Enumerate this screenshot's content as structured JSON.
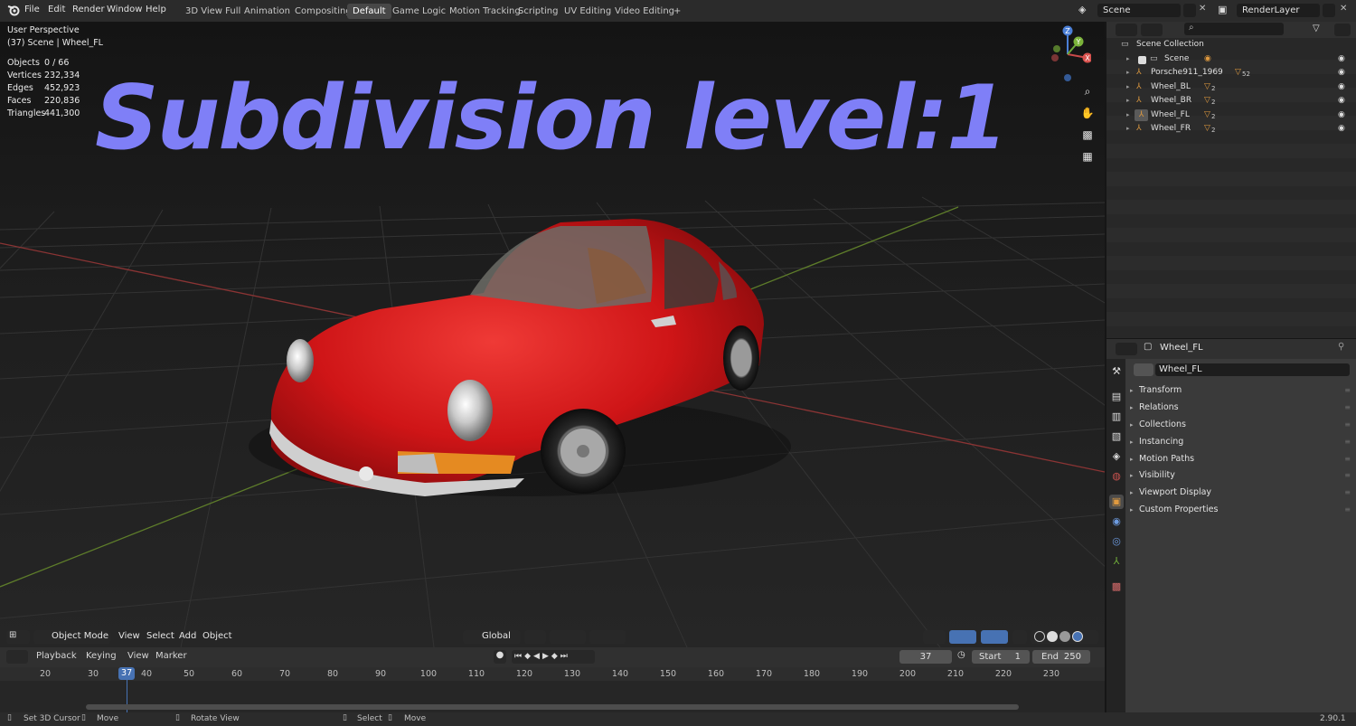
{
  "menu": [
    "File",
    "Edit",
    "Render",
    "Window",
    "Help"
  ],
  "workspaces": [
    "3D View Full",
    "Animation",
    "Compositing",
    "Default",
    "Game Logic",
    "Motion Tracking",
    "Scripting",
    "UV Editing",
    "Video Editing"
  ],
  "active_workspace": "Default",
  "add_tab": "+",
  "scene_field": "Scene",
  "render_layer_field": "RenderLayer",
  "viewport": {
    "perspective": "User Perspective",
    "context": "(37) Scene | Wheel_FL",
    "stats": [
      {
        "label": "Objects",
        "value": "0 / 66"
      },
      {
        "label": "Vertices",
        "value": "232,334"
      },
      {
        "label": "Edges",
        "value": "452,923"
      },
      {
        "label": "Faces",
        "value": "220,836"
      },
      {
        "label": "Triangles",
        "value": "441,300"
      }
    ],
    "overlay_title": "Subdivision level:1",
    "gizmo": {
      "x": "X",
      "y": "Y",
      "z": "Z"
    }
  },
  "viewport_header": {
    "mode": "Object Mode",
    "menus": [
      "View",
      "Select",
      "Add",
      "Object"
    ],
    "orientation": "Global"
  },
  "timeline": {
    "menus": [
      "Playback",
      "Keying",
      "View",
      "Marker"
    ],
    "current_frame": "37",
    "start_label": "Start",
    "start": "1",
    "end_label": "End",
    "end": "250",
    "ticks": [
      "20",
      "30",
      "40",
      "50",
      "60",
      "70",
      "80",
      "90",
      "100",
      "110",
      "120",
      "130",
      "140",
      "150",
      "160",
      "170",
      "180",
      "190",
      "200",
      "210",
      "220",
      "230"
    ],
    "playhead": "37"
  },
  "statusbar": {
    "items": [
      "Set 3D Cursor",
      "Move",
      "Rotate View",
      "Select",
      "Move"
    ],
    "version": "2.90.1"
  },
  "outliner": {
    "rows": [
      {
        "name": "Scene Collection",
        "badge": ""
      },
      {
        "name": "Scene",
        "badge": ""
      },
      {
        "name": "Porsche911_1969",
        "badge": "52"
      },
      {
        "name": "Wheel_BL",
        "badge": "2"
      },
      {
        "name": "Wheel_BR",
        "badge": "2"
      },
      {
        "name": "Wheel_FL",
        "badge": "2"
      },
      {
        "name": "Wheel_FR",
        "badge": "2"
      }
    ]
  },
  "properties": {
    "object_name": "Wheel_FL",
    "datablock_name": "Wheel_FL",
    "panels": [
      "Transform",
      "Relations",
      "Collections",
      "Instancing",
      "Motion Paths",
      "Visibility",
      "Viewport Display",
      "Custom Properties"
    ]
  },
  "colors": {
    "accent_blue": "#4772b3",
    "overlay_text": "#7f7ff7",
    "car_red": "#d4161a",
    "axis_red": "#8a3434",
    "axis_green": "#5e7d2a",
    "orange_icon": "#e09a3f"
  }
}
